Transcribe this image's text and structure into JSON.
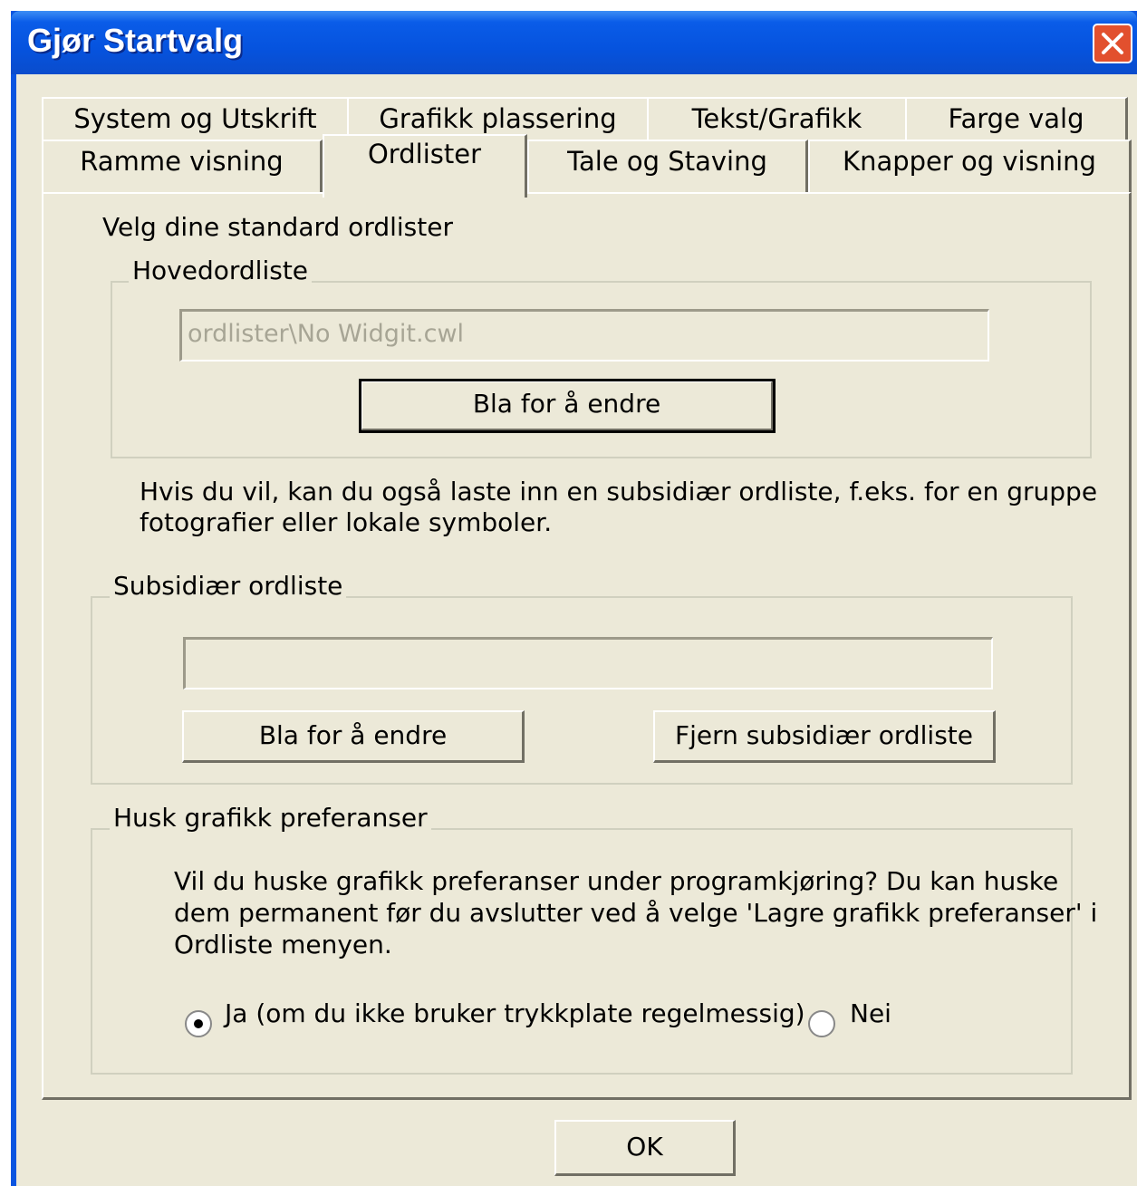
{
  "window": {
    "title": "Gjør Startvalg"
  },
  "tabs": {
    "row1": [
      "System og Utskrift",
      "Grafikk plassering",
      "Tekst/Grafikk",
      "Farge valg"
    ],
    "row2": [
      "Ramme visning",
      "Ordlister",
      "Tale og Staving",
      "Knapper og visning"
    ],
    "active": "Ordlister"
  },
  "ordlister": {
    "intro": "Velg dine standard ordlister",
    "main_group": {
      "label": "Hovedordliste",
      "path_value": "ordlister\\No Widgit.cwl",
      "browse_label": "Bla for å endre"
    },
    "subsidiary_info": [
      "Hvis du vil, kan du også laste inn en subsidiær ordliste, f.eks. for en gruppe",
      "fotografier eller lokale symboler."
    ],
    "subsidiary_group": {
      "label": "Subsidiær ordliste",
      "path_value": "",
      "browse_label": "Bla for å endre",
      "remove_label": "Fjern subsidiær ordliste"
    },
    "remember_group": {
      "label": "Husk grafikk preferanser",
      "description": [
        "Vil du huske grafikk preferanser under programkjøring? Du kan huske",
        "dem permanent før du avslutter ved å velge 'Lagre grafikk preferanser' i",
        "Ordliste menyen."
      ],
      "option_yes": "Ja (om du ikke bruker trykkplate regelmessig)",
      "option_no": "Nei",
      "selected": "yes"
    }
  },
  "footer": {
    "ok_label": "OK"
  }
}
